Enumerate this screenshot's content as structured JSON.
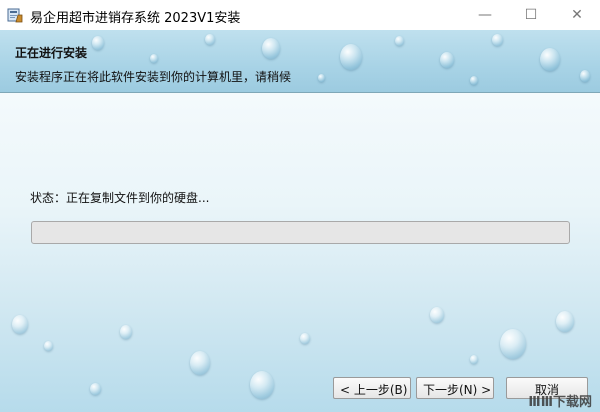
{
  "window": {
    "title": "易企用超市进销存系统 2023V1安装",
    "icon": "installer-icon",
    "controls": [
      "minimize-icon",
      "maximize-icon",
      "close-icon"
    ]
  },
  "header": {
    "title": "正在进行安装",
    "description": "安装程序正在将此软件安装到你的计算机里，请稍候"
  },
  "main": {
    "status_text": "状态：正在复制文件到你的硬盘...",
    "progress_fraction": 0
  },
  "buttons": {
    "back_label": "< 上一步(B)",
    "next_label": "下一步(N) >",
    "cancel_label": "取消"
  },
  "watermark": "ⅢⅢ下载网",
  "colors": {
    "header_bg": "#a8d3e6",
    "progress_bg": "#e6e6e6"
  }
}
